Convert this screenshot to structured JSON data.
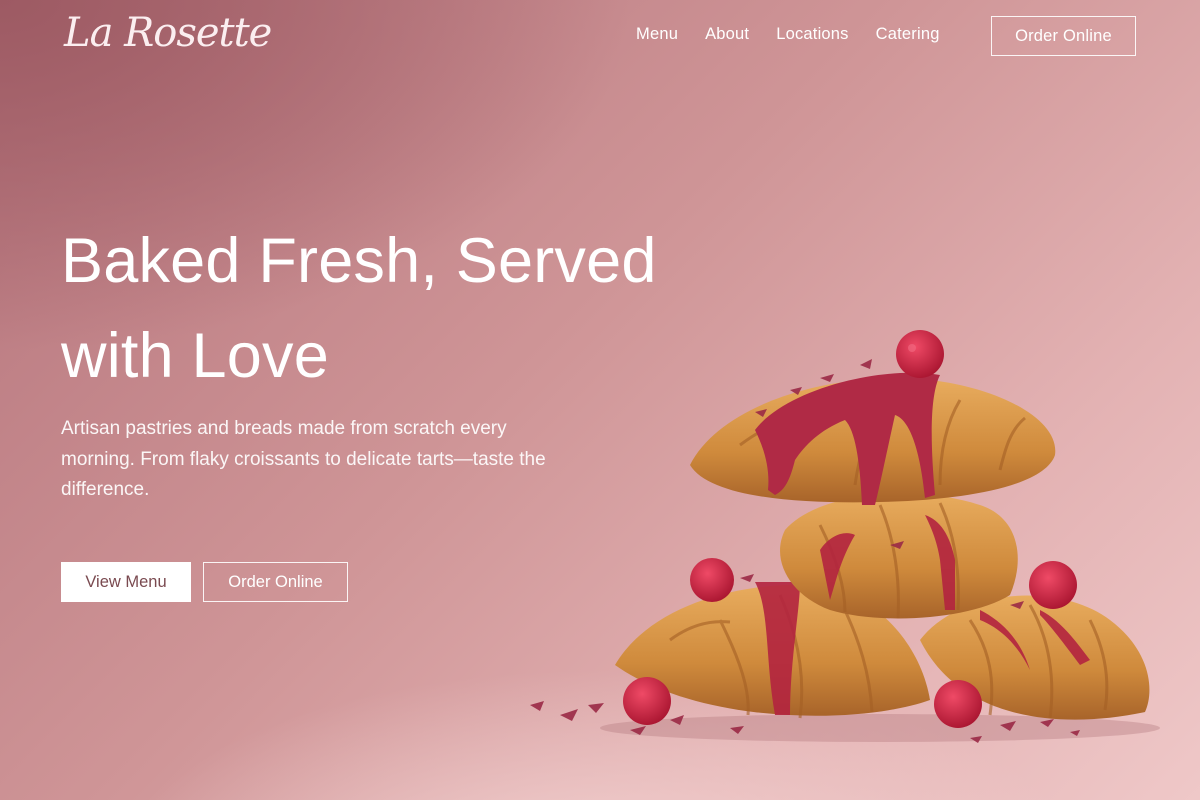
{
  "brand": {
    "logo_text": "La Rosette"
  },
  "nav": {
    "items": [
      {
        "label": "Menu"
      },
      {
        "label": "About"
      },
      {
        "label": "Locations"
      },
      {
        "label": "Catering"
      }
    ],
    "cta_label": "Order Online"
  },
  "hero": {
    "title_line1": "Baked Fresh, Served",
    "title_line2": "with Love",
    "subtitle": "Artisan pastries and breads made from scratch every morning. From flaky croissants to delicate tarts—taste the difference.",
    "primary_button": "View Menu",
    "secondary_button": "Order Online",
    "image_subject": "stacked-croissants-with-raspberry-glaze"
  },
  "colors": {
    "background_dark": "#9d5a63",
    "background_light": "#efc8c8",
    "primary_button_text": "#7a4a50",
    "croissant": "#d9974a",
    "glaze": "#b02a45",
    "raspberry": "#c8233f"
  }
}
